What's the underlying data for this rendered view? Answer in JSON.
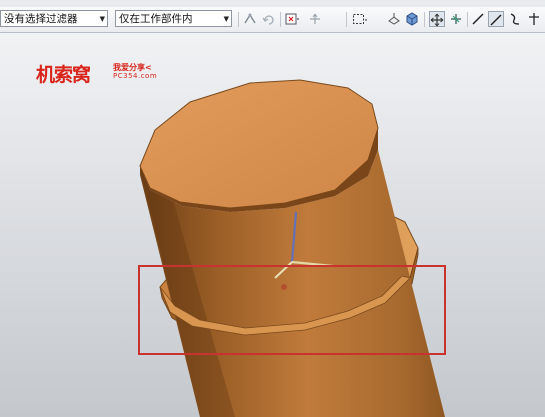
{
  "toolbar": {
    "filter_dropdown": "没有选择过滤器",
    "scope_dropdown": "仅在工作部件内",
    "icons": [
      "snap-point-icon",
      "undo-icon",
      "point-dialog-icon",
      "axis-icon",
      "select-rectangle-icon",
      "view-icon",
      "shaded-icon",
      "move-pan-icon",
      "rotate-icon",
      "line-icon",
      "line-active-icon",
      "curve-icon",
      "axis-cross-icon"
    ]
  },
  "watermark": {
    "main": "机索窝",
    "sub_top": "我爱分享<",
    "sub_bottom": "PC354.com"
  },
  "colors": {
    "cylinder_body": "#9a5e26",
    "cylinder_top": "#d9904f",
    "highlight_box": "#c8322f",
    "brand_red": "#d9251c"
  }
}
